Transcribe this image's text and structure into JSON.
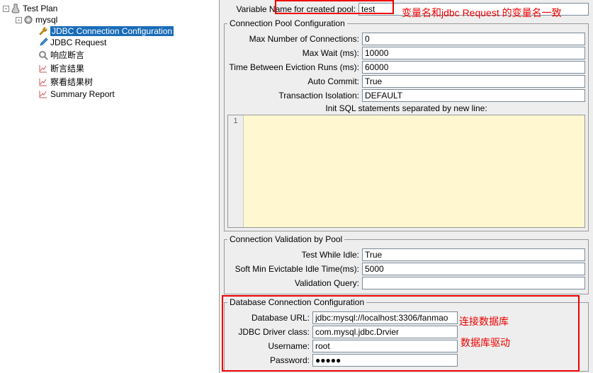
{
  "tree": {
    "root": "Test Plan",
    "thread": "mysql",
    "items": [
      "JDBC Connection Configuration",
      "JDBC Request",
      "响应断言",
      "断言结果",
      "察看结果树",
      "Summary Report"
    ]
  },
  "varname_label": "Variable Name for created pool:",
  "varname_value": "test",
  "pool": {
    "legend": "Connection Pool Configuration",
    "max_conn_label": "Max Number of Connections:",
    "max_conn_value": "0",
    "max_wait_label": "Max Wait (ms):",
    "max_wait_value": "10000",
    "evict_label": "Time Between Eviction Runs (ms):",
    "evict_value": "60000",
    "auto_commit_label": "Auto Commit:",
    "auto_commit_value": "True",
    "trans_iso_label": "Transaction Isolation:",
    "trans_iso_value": "DEFAULT",
    "init_sql_label": "Init SQL statements separated by new line:"
  },
  "valid": {
    "legend": "Connection Validation by Pool",
    "test_idle_label": "Test While Idle:",
    "test_idle_value": "True",
    "soft_evict_label": "Soft Min Evictable Idle Time(ms):",
    "soft_evict_value": "5000",
    "query_label": "Validation Query:",
    "query_value": ""
  },
  "db": {
    "legend": "Database Connection Configuration",
    "url_label": "Database URL:",
    "url_value": "jdbc:mysql://localhost:3306/fanmao",
    "driver_label": "JDBC Driver class:",
    "driver_value": "com.mysql.jdbc.Drvier",
    "user_label": "Username:",
    "user_value": "root",
    "pass_label": "Password:",
    "pass_value": "●●●●●"
  },
  "annot": {
    "a1": "变量名和jdbc Request 的变量名一致",
    "a2": "连接数据库",
    "a3": "数据库驱动"
  },
  "gutter_num": "1"
}
